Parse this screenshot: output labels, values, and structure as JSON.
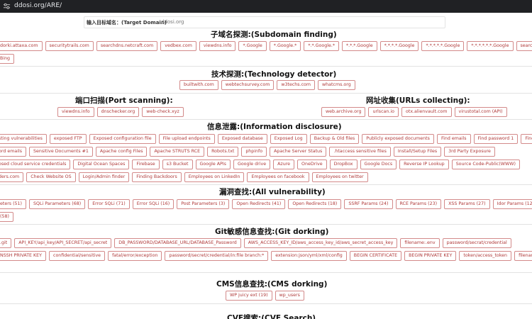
{
  "browser": {
    "url": "ddosi.org/ARE/"
  },
  "target": {
    "label": "输入目标域名：(Target Domain)",
    "value": "ddosi.org"
  },
  "sections": {
    "subdomain": {
      "title": "子域名探测:(Subdomain finding)",
      "row1": [
        "dorki.attaxa.com",
        "securitytrails.com",
        "searchdns.netcraft.com",
        "vedbex.com",
        "viewdns.info",
        "*.Google",
        "*.Google.*",
        "*.*.Google.*",
        "*.*.*.Google",
        "*.*.*.*.Google",
        "*.*.*.*.*.Google",
        "*.*.*.*.*.*.Google",
        "search.censys.io"
      ],
      "row2": [
        "Bing"
      ]
    },
    "tech": {
      "title": "技术探测:(Technology detector)",
      "row1": [
        "builtwith.com",
        "webtechsurvey.com",
        "w3techs.com",
        "whatcms.org"
      ]
    },
    "ports": {
      "title": "端口扫描(Port scanning):",
      "row1": [
        "viewdns.info",
        "dnschecker.org",
        "web-check.xyz"
      ]
    },
    "urls": {
      "title": "网址收集(URLs collecting):",
      "row1": [
        "web.archive.org",
        "urlscan.io",
        "otx.alienvault.com",
        "virustotal.com (API)"
      ]
    },
    "info": {
      "title": "信息泄露:(Information disclosure)",
      "row1": [
        "sting vulnerabilities",
        "exposed FTP",
        "Exposed configuration file",
        "File upload endpoints",
        "Exposed database",
        "Exposed Log",
        "Backup & Old files",
        "Publicly exposed documents",
        "Find emails",
        "Find password 1",
        "Find password 2"
      ],
      "row2": [
        "ord emails",
        "Sensitive Documents #1",
        "Apache config Files",
        "Apache STRUTS RCE",
        "Robots.txt",
        "phpinfo",
        "Apache Server Status",
        ".htaccess sensitive files",
        "Install/Setup Files",
        "3rd Party Exposure"
      ],
      "row3": [
        "osed cloud service credentials",
        "Digital Ocean Spaces",
        "Firebase",
        "s3 Bucket",
        "Google APIs",
        "Google drive",
        "Azure",
        "OneDrive",
        "DropBox",
        "Google Docs",
        "Reverse IP Lookup",
        "Source Code-Public(WWW)"
      ],
      "row4": [
        "ders.com",
        "Check Website OS",
        "Login/Admin finder",
        "Finding Backdoors",
        "Employees on LinkedIn",
        "Employees on facebook",
        "Employees on twitter"
      ]
    },
    "vuln": {
      "title": "漏洞查找:(All vulnerability)",
      "row1": [
        "eters (51)",
        "SQLi Parameters (68)",
        "Error SQLi (71)",
        "Error SQLi (16)",
        "Post Parameters (3)",
        "Open Redirects (41)",
        "Open Redirects (18)",
        "SSRF Params (24)",
        "RCE Params (23)",
        "XSS Params (27)",
        "Idor Params (12)",
        "LFI Params"
      ],
      "row2": [
        "(58)"
      ]
    },
    "git": {
      "title": "Git敏感信息查找:(Git dorking)",
      "row1": [
        ".git",
        "API_KEY/api_key/API_SECRET/api_secret",
        "DB_PASSWORD/DATABASE_URL/DATABASE_Password",
        "AWS_ACCESS_KEY_ID/aws_access_key_id/aws_secret_access_key",
        "filename:.env",
        "password/secrat/credential"
      ],
      "row2": [
        "NSSH PRIVATE KEY",
        "confidential/sensitive",
        "fatal/error/exception",
        "password/secret/credential/in:file branch:*",
        "extension:json/yml/xml/config",
        "BEGIN CERTIFICATE",
        "BEGIN PRIVATE KEY",
        "token/access_token",
        "filename:config/setting"
      ]
    },
    "cms": {
      "title": "CMS信息查找:(CMS dorking)",
      "row1": [
        "WP juicy ext (19)",
        "wp_users"
      ]
    },
    "cve": {
      "title": "CVE搜索:(CVE Search)"
    }
  }
}
